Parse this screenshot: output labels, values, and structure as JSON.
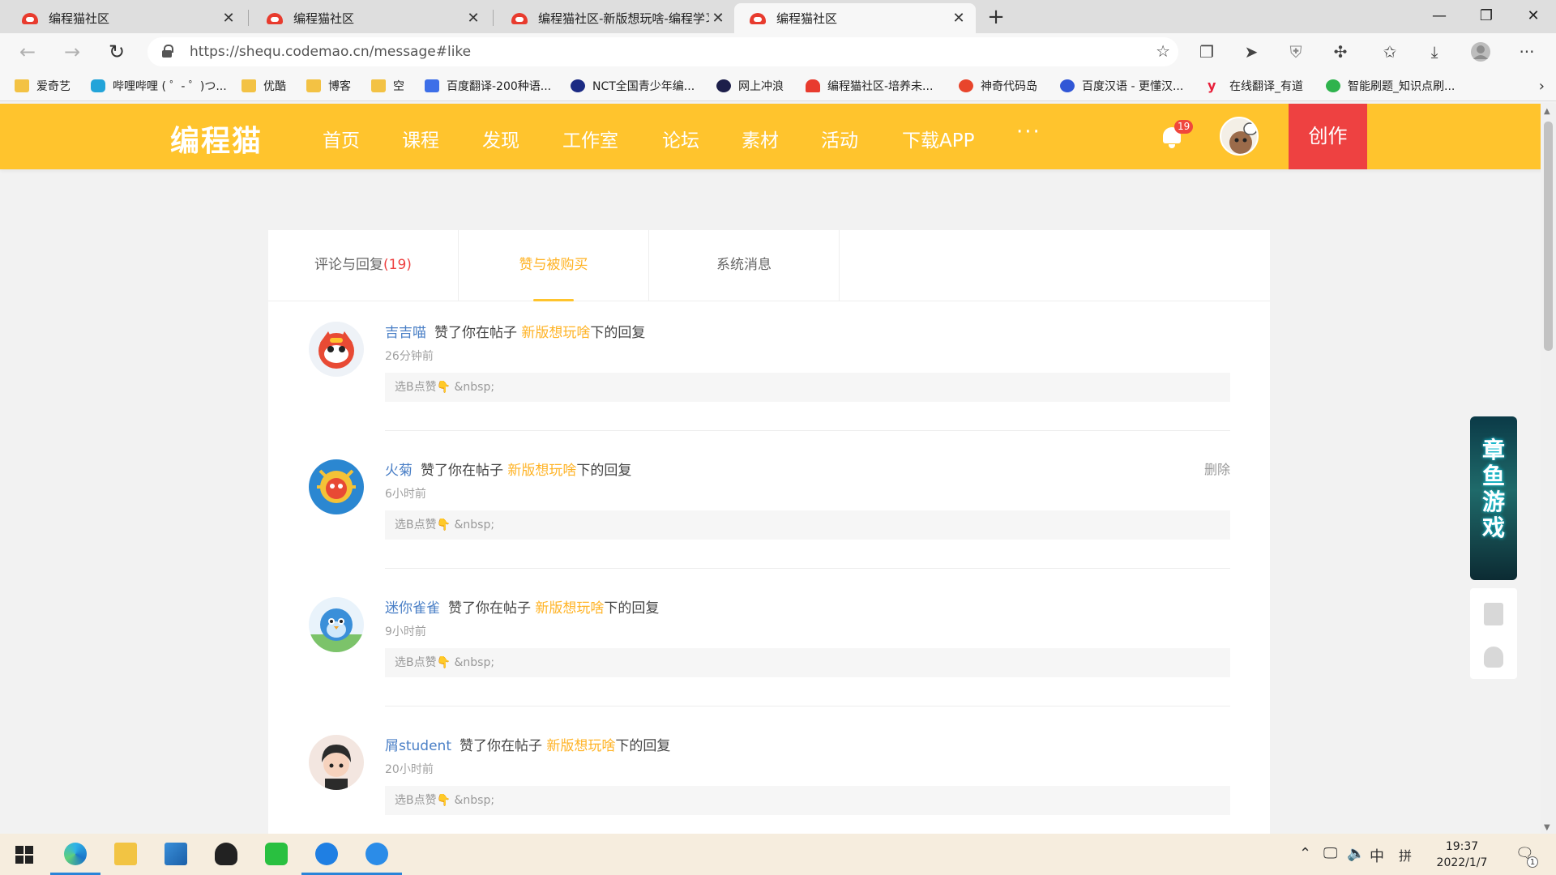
{
  "browser": {
    "tabs": [
      {
        "title": "编程猫社区"
      },
      {
        "title": "编程猫社区"
      },
      {
        "title": "编程猫社区-新版想玩啥-编程学习"
      },
      {
        "title": "编程猫社区"
      }
    ],
    "new_tab": "+",
    "window_controls": {
      "minimize": "—",
      "maximize": "❐",
      "close": "✕"
    },
    "url": "https://shequ.codemao.cn/message#like",
    "toolbar_icons": [
      "collections-icon",
      "share-icon",
      "shield-icon",
      "extensions-icon",
      "favorites-icon",
      "download-icon",
      "profile-icon",
      "more-icon"
    ],
    "bookmarks": [
      {
        "label": "爱奇艺",
        "icon": "folder"
      },
      {
        "label": "哔哩哔哩 ( ゜- ゜)つ...",
        "icon": "bili"
      },
      {
        "label": "优酷",
        "icon": "folder"
      },
      {
        "label": "博客",
        "icon": "folder"
      },
      {
        "label": "空",
        "icon": "folder"
      },
      {
        "label": "百度翻译-200种语...",
        "icon": "trans"
      },
      {
        "label": "NCT全国青少年编...",
        "icon": "nct"
      },
      {
        "label": "网上冲浪",
        "icon": "dark"
      },
      {
        "label": "编程猫社区-培养未...",
        "icon": "cat"
      },
      {
        "label": "神奇代码岛",
        "icon": "star"
      },
      {
        "label": "百度汉语 - 更懂汉...",
        "icon": "baidu"
      },
      {
        "label": "在线翻译_有道",
        "icon": "yd"
      },
      {
        "label": "智能刷题_知识点刷...",
        "icon": "zn"
      }
    ]
  },
  "site": {
    "logo": "编程猫",
    "nav": [
      "首页",
      "课程",
      "发现",
      "工作室",
      "论坛",
      "素材",
      "活动",
      "下载APP"
    ],
    "nav_more": "···",
    "notification_count": "19",
    "create_label": "创作"
  },
  "messages": {
    "tabs": [
      {
        "label": "评论与回复",
        "count": "(19)"
      },
      {
        "label": "赞与被购买",
        "count": ""
      },
      {
        "label": "系统消息",
        "count": ""
      }
    ],
    "active_tab": 1,
    "items": [
      {
        "user": "吉吉喵",
        "action": "赞了你在帖子",
        "post": "新版想玩啥",
        "suffix": "下的回复",
        "time": "26分钟前",
        "quote": "选B点赞👇 &nbsp;",
        "delete": ""
      },
      {
        "user": "火菊",
        "action": "赞了你在帖子",
        "post": "新版想玩啥",
        "suffix": "下的回复",
        "time": "6小时前",
        "quote": "选B点赞👇 &nbsp;",
        "delete": "删除"
      },
      {
        "user": "迷你雀雀",
        "action": "赞了你在帖子",
        "post": "新版想玩啥",
        "suffix": "下的回复",
        "time": "9小时前",
        "quote": "选B点赞👇 &nbsp;",
        "delete": ""
      },
      {
        "user": "屑student",
        "action": "赞了你在帖子",
        "post": "新版想玩啥",
        "suffix": "下的回复",
        "time": "20小时前",
        "quote": "选B点赞👇 &nbsp;",
        "delete": ""
      }
    ]
  },
  "side": {
    "ad_text": "章鱼游戏"
  },
  "taskbar": {
    "apps": [
      "start-icon",
      "edge-icon",
      "explorer-icon",
      "photos-icon",
      "qq-icon",
      "wechat-icon",
      "kugou-icon",
      "feishu-icon"
    ],
    "ime_lang": "中",
    "ime_mode": "拼",
    "time": "19:37",
    "date": "2022/1/7",
    "notification_count": "1"
  },
  "colors": {
    "header_yellow": "#ffc42d",
    "create_red": "#ee4141",
    "link_blue": "#4a7fc6",
    "post_orange": "#ffb325"
  }
}
